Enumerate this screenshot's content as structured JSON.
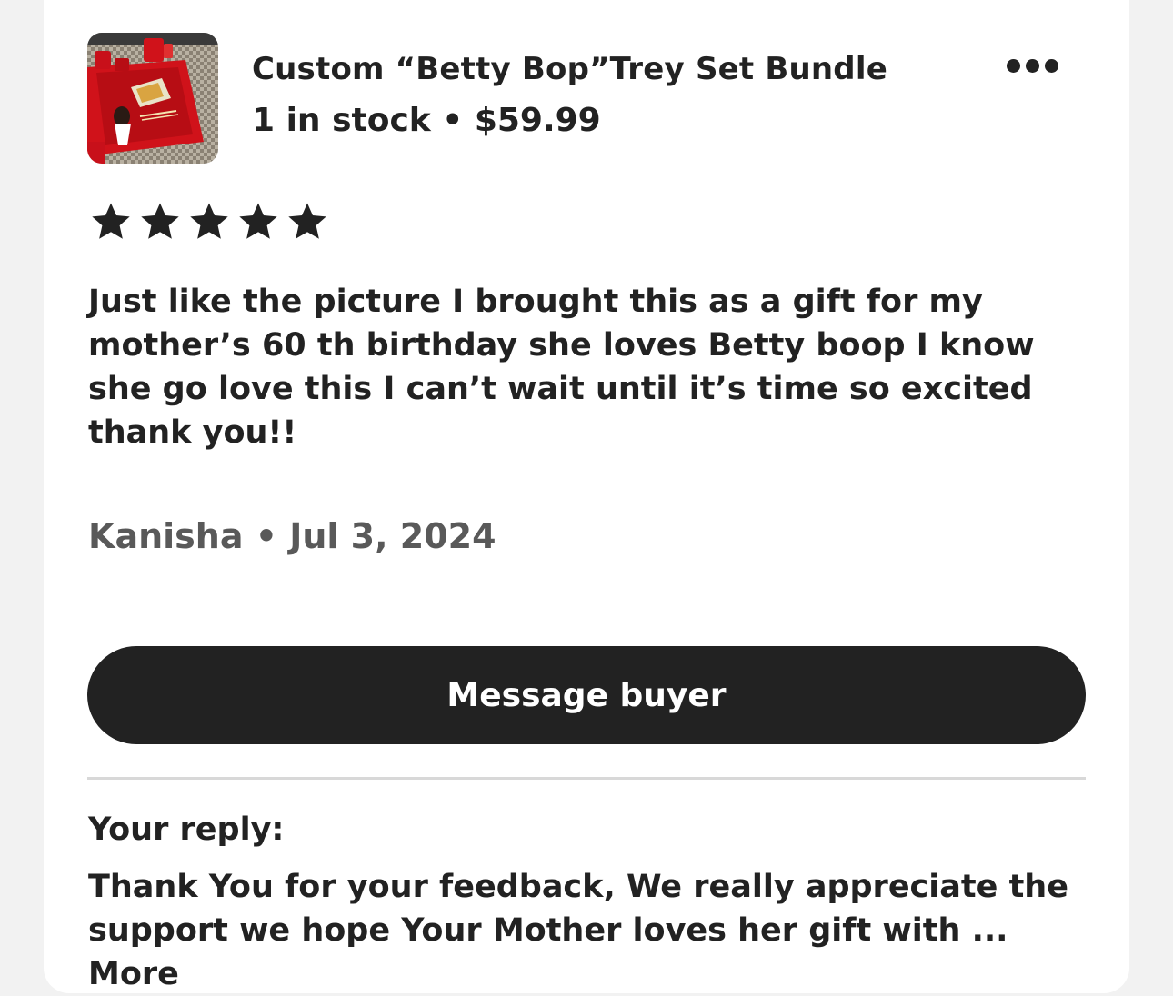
{
  "listing": {
    "thumbnail_icon": "product-photo-red-tray-set",
    "title": "Custom “Betty Bop”Trey Set Bundle",
    "stock": "1 in stock",
    "separator": " • ",
    "price": "$59.99"
  },
  "menu": {
    "icon": "more-options-icon"
  },
  "rating": {
    "stars": 5,
    "max": 5
  },
  "review": {
    "text": "Just like the picture I brought this as a gift for my mother’s 60 th birthday she loves Betty boop I know she go love this I can’t wait until it’s time so excited thank you!!",
    "author": "Kanisha",
    "separator": " • ",
    "date": "Jul 3, 2024"
  },
  "actions": {
    "message_label": "Message buyer"
  },
  "reply": {
    "label": "Your reply:",
    "text": "Thank You for your feedback, We really appreciate the support we hope Your Mother loves her gift with ...",
    "more_label": "More"
  },
  "colors": {
    "background": "#f2f2f2",
    "card": "#ffffff",
    "text": "#222222",
    "muted": "#595959",
    "button": "#222222",
    "divider": "#d8d8d8"
  }
}
